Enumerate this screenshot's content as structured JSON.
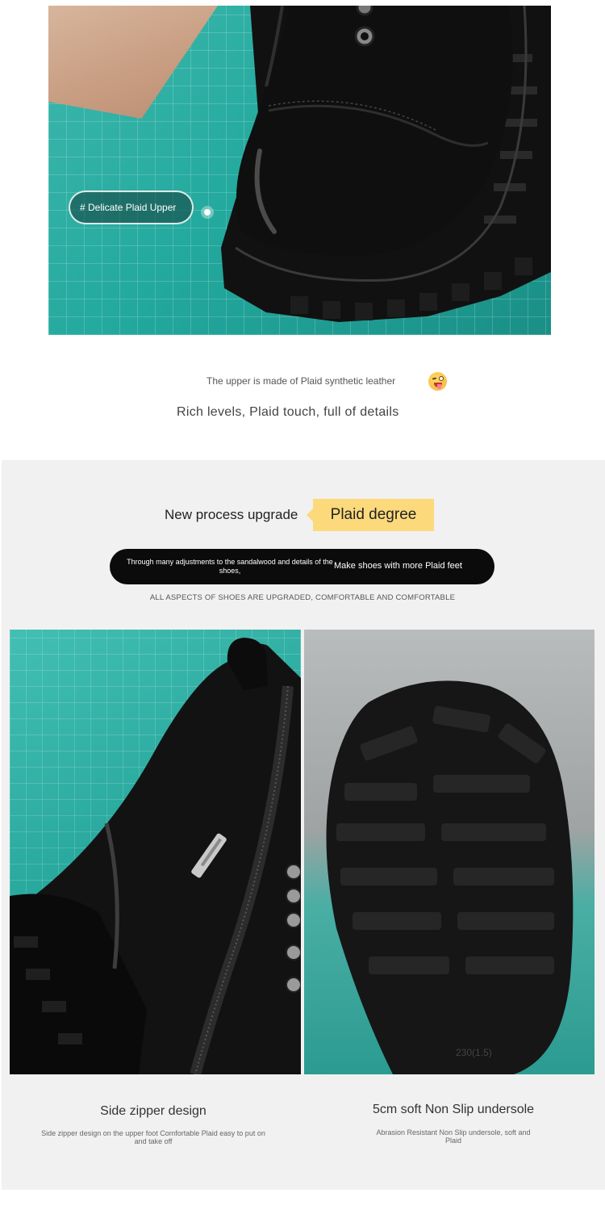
{
  "hero": {
    "tag_label": "# Delicate Plaid Upper"
  },
  "caption": {
    "line1": "The upper is made of Plaid synthetic leather",
    "emoji_icon": "winking-tongue-face-emoji",
    "line2": "Rich levels, Plaid touch, full of details"
  },
  "upgrade": {
    "label": "New process upgrade",
    "highlight": "Plaid degree",
    "highlight_color": "#fcd97b",
    "pill_left": "Through many adjustments to the sandalwood and details of the shoes,",
    "pill_right": "Make shoes with more Plaid feet",
    "caps_line": "ALL ASPECTS OF SHOES ARE UPGRADED, COMFORTABLE AND COMFORTABLE"
  },
  "features": [
    {
      "title": "Side zipper design",
      "desc": "Side zipper design on the upper foot Comfortable Plaid easy to put on and take off"
    },
    {
      "title": "5cm soft Non Slip undersole",
      "desc": "Abrasion Resistant Non Slip undersole, soft and Plaid"
    }
  ],
  "sole_mark": "230(1.5)",
  "colors": {
    "mat_teal": "#23a99e",
    "section_grey": "#f1f1f1",
    "pill_black": "#0b0b0b"
  }
}
